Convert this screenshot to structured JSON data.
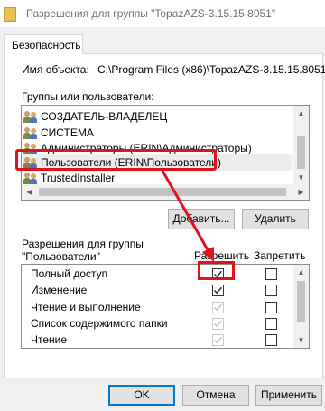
{
  "window": {
    "title": "Разрешения для группы \"TopazAZS-3.15.15.8051\""
  },
  "tabs": [
    {
      "label": "Безопасность"
    }
  ],
  "object": {
    "label": "Имя объекта:",
    "value": "C:\\Program Files (x86)\\TopazAZS-3.15.15.8051"
  },
  "groups": {
    "label": "Группы или пользователи:",
    "items": [
      {
        "name": "СОЗДАТЕЛЬ-ВЛАДЕЛЕЦ",
        "selected": false
      },
      {
        "name": "СИСТЕМА",
        "selected": false
      },
      {
        "name": "Администраторы (ERIN\\Администраторы)",
        "selected": false
      },
      {
        "name": "Пользователи (ERIN\\Пользователи)",
        "selected": true
      },
      {
        "name": "TrustedInstaller",
        "selected": false
      }
    ]
  },
  "buttons": {
    "add": "Добавить...",
    "remove": "Удалить",
    "ok": "OK",
    "cancel": "Отмена",
    "apply": "Применить"
  },
  "permissions": {
    "title_line1": "Разрешения для группы",
    "title_line2": "\"Пользователи\"",
    "allow_header": "Разрешить",
    "deny_header": "Запретить",
    "items": [
      {
        "name": "Полный доступ",
        "allow": true,
        "allow_inherited": false,
        "deny": false
      },
      {
        "name": "Изменение",
        "allow": true,
        "allow_inherited": false,
        "deny": false
      },
      {
        "name": "Чтение и выполнение",
        "allow": true,
        "allow_inherited": true,
        "deny": false
      },
      {
        "name": "Список содержимого папки",
        "allow": true,
        "allow_inherited": true,
        "deny": false
      },
      {
        "name": "Чтение",
        "allow": true,
        "allow_inherited": true,
        "deny": false
      }
    ]
  },
  "colors": {
    "highlight": "#e0121b",
    "focus_border": "#0078d7",
    "dialog_bg": "#f0f0f0"
  }
}
